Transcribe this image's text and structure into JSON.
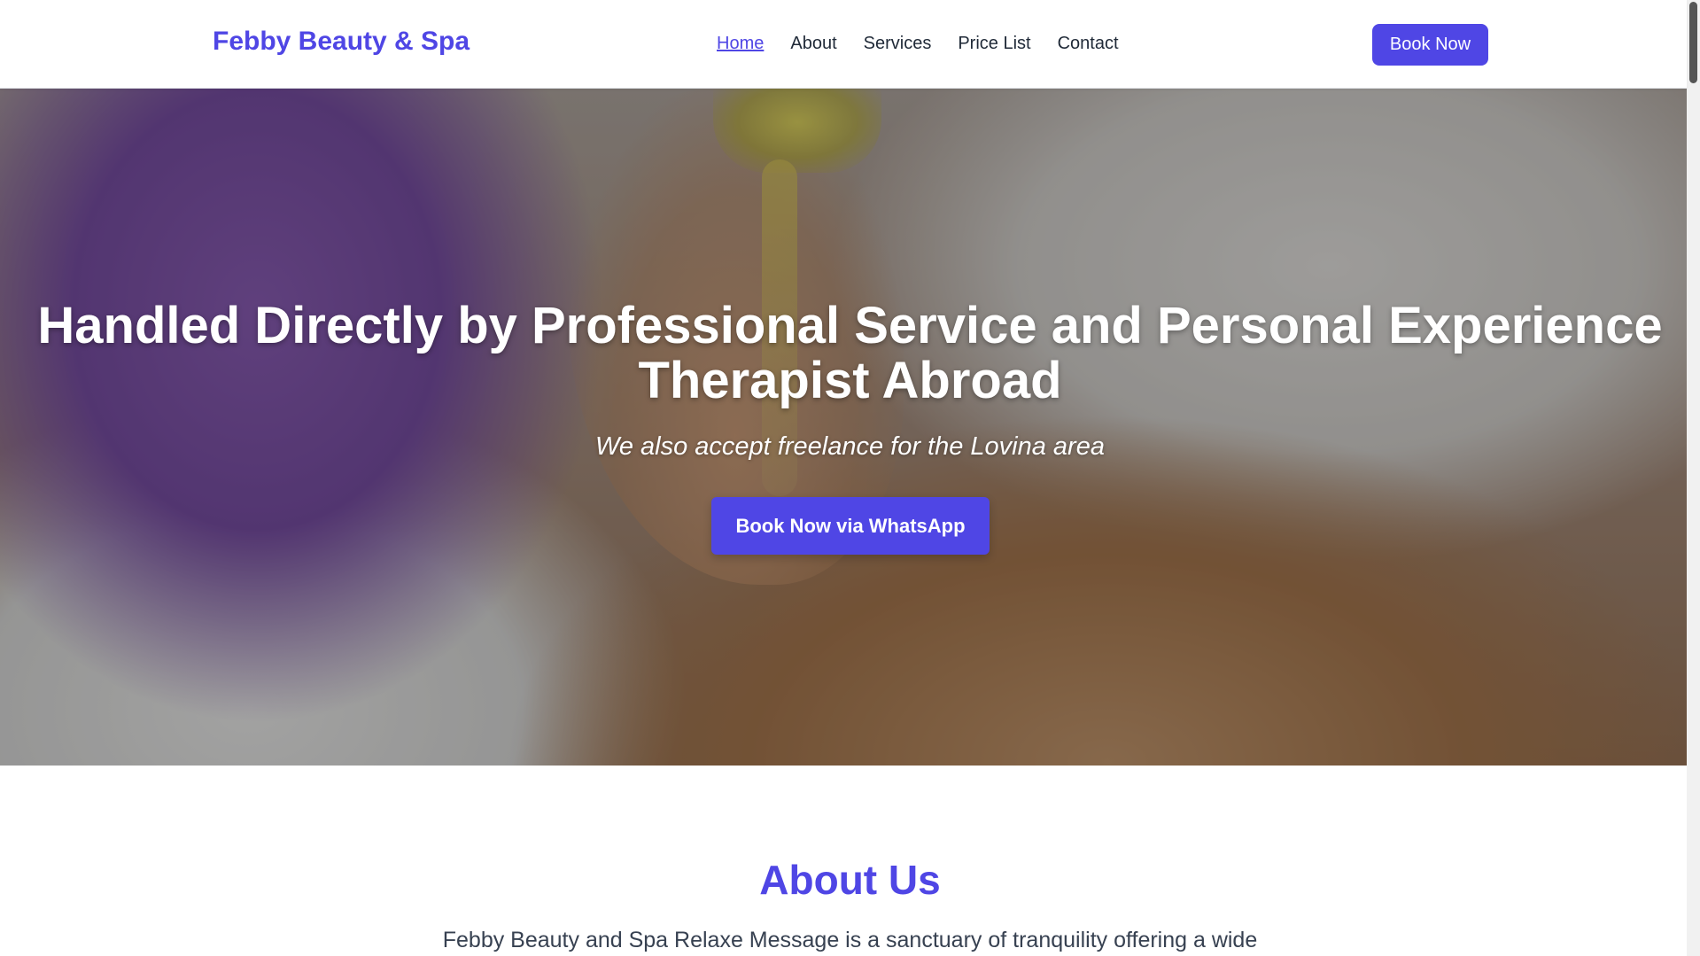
{
  "header": {
    "brand": "Febby Beauty & Spa",
    "nav": [
      {
        "label": "Home",
        "active": true
      },
      {
        "label": "About",
        "active": false
      },
      {
        "label": "Services",
        "active": false
      },
      {
        "label": "Price List",
        "active": false
      },
      {
        "label": "Contact",
        "active": false
      }
    ],
    "cta_label": "Book Now"
  },
  "hero": {
    "title": "Handled Directly by Professional Service and Personal Experience Therapist Abroad",
    "subtitle": "We also accept freelance for the Lovina area",
    "cta_label": "Book Now via WhatsApp"
  },
  "about": {
    "title": "About Us",
    "text": "Febby Beauty and Spa Relaxe Message is a sanctuary of tranquility offering a wide"
  },
  "colors": {
    "accent": "#4f46e5",
    "text": "#1f2937"
  }
}
